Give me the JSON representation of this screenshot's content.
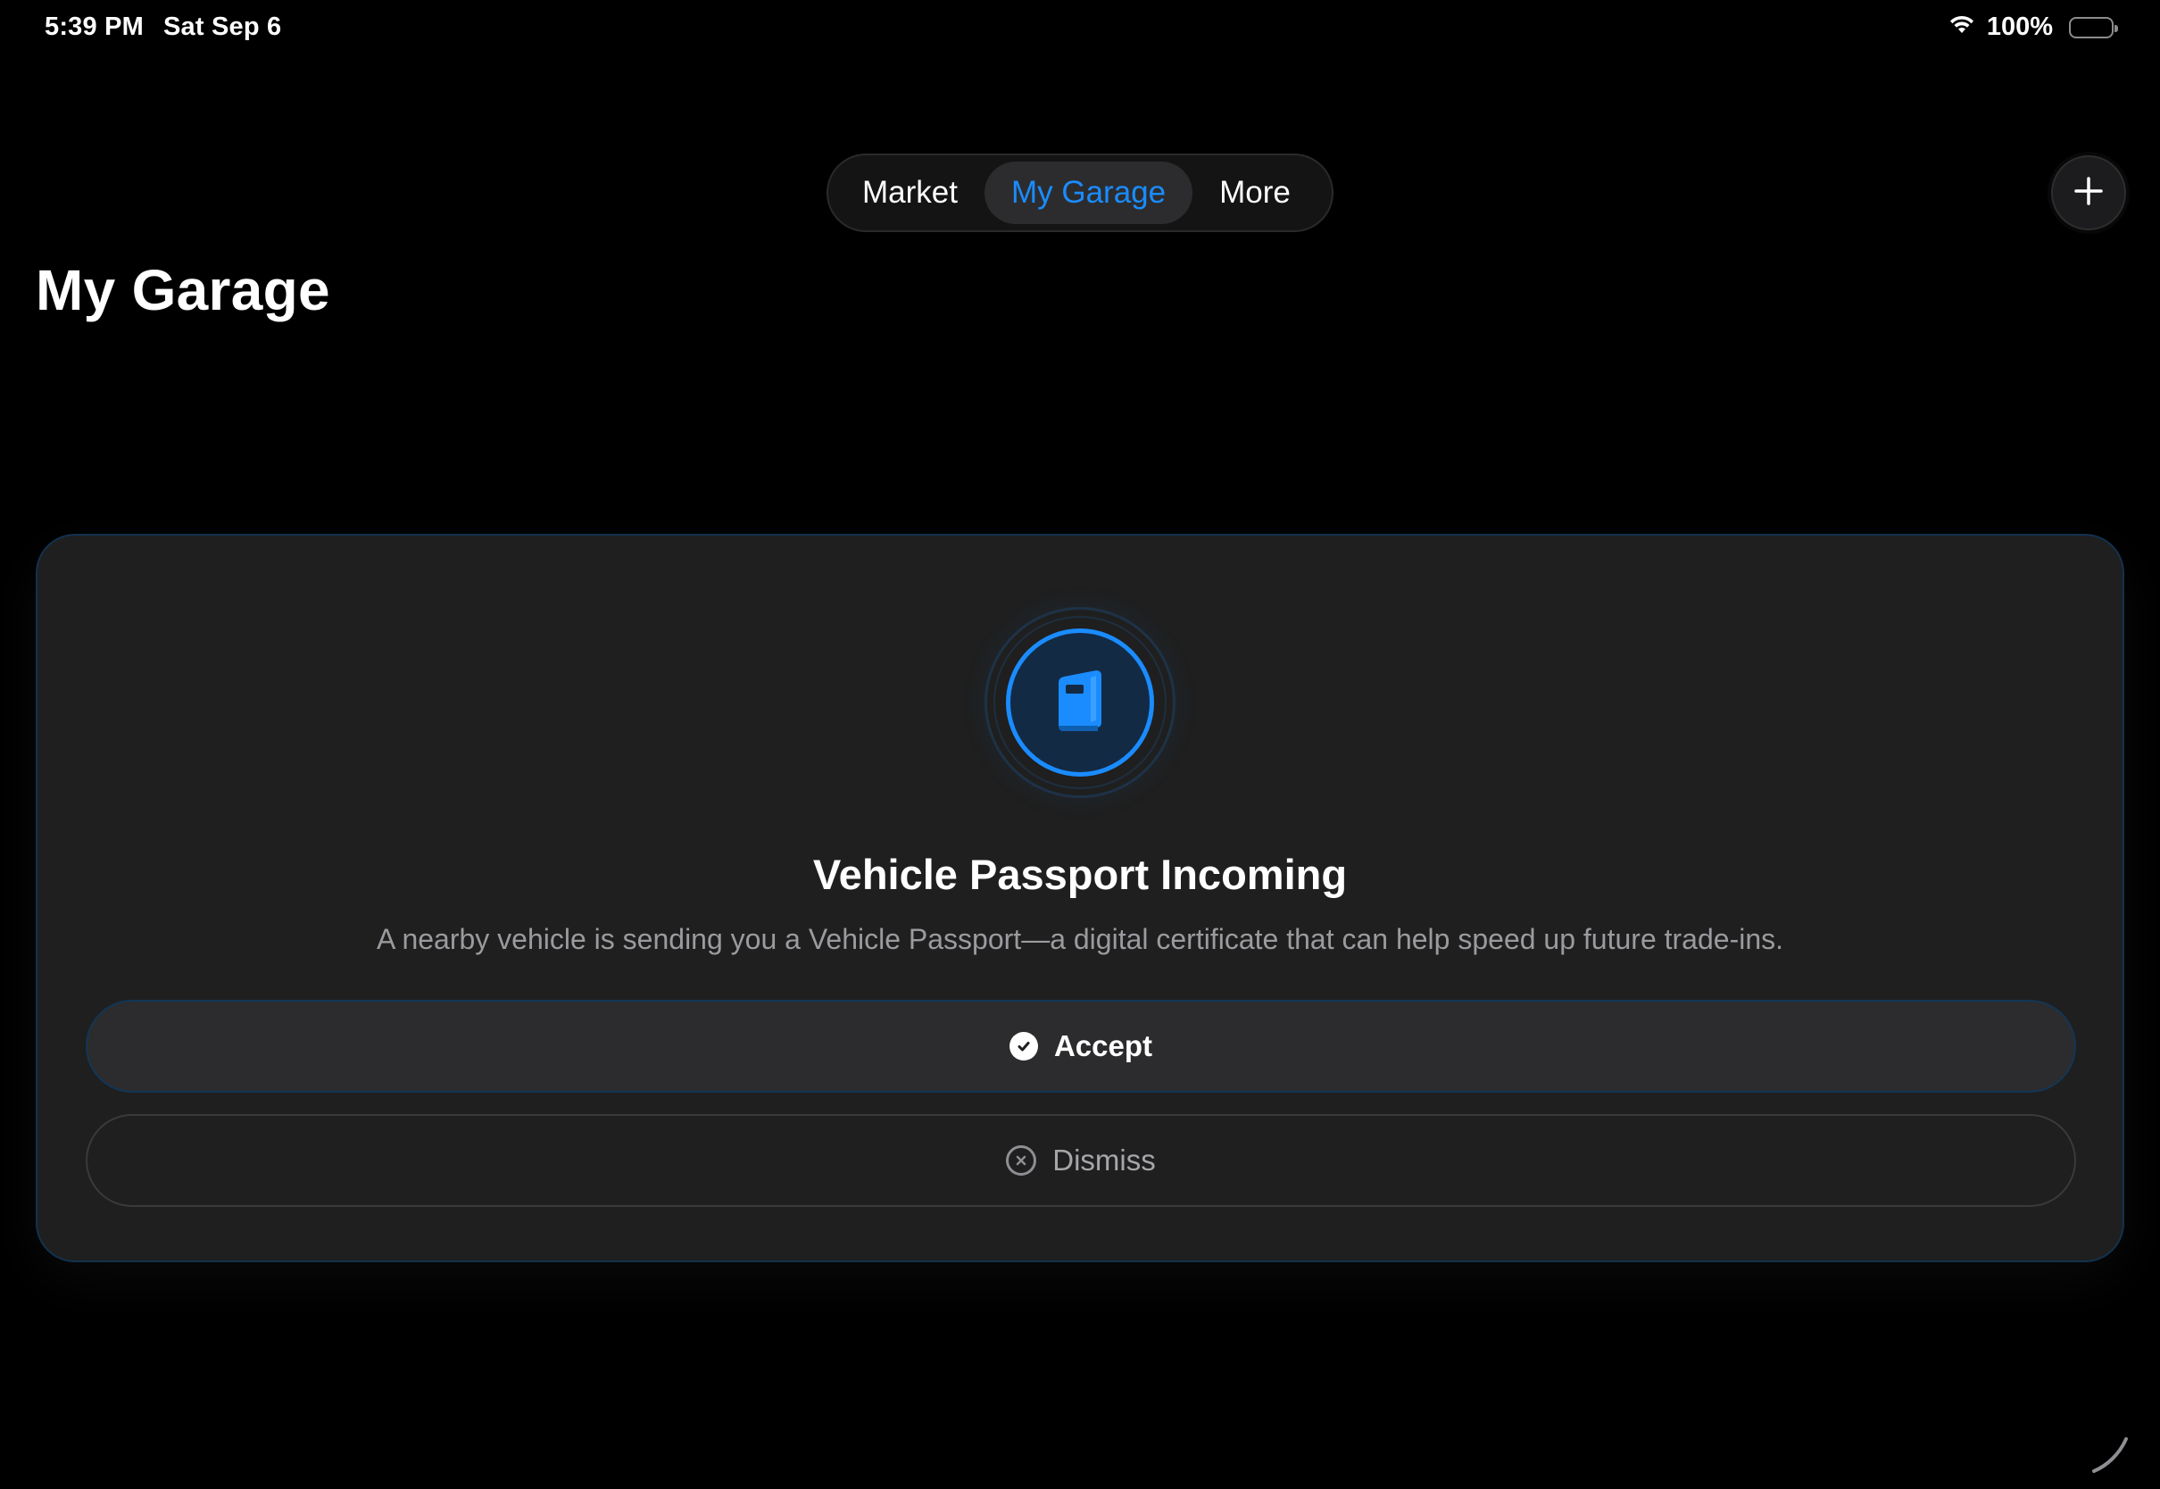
{
  "status_bar": {
    "time": "5:39 PM",
    "date": "Sat Sep 6",
    "battery_percent": "100%",
    "battery_level": 1.0,
    "icons": [
      "wifi-icon",
      "battery-icon"
    ]
  },
  "nav": {
    "tabs": [
      {
        "label": "Market",
        "active": false
      },
      {
        "label": "My Garage",
        "active": true
      },
      {
        "label": "More",
        "active": false
      }
    ],
    "add_icon": "plus-icon"
  },
  "page": {
    "title": "My Garage"
  },
  "card": {
    "icon": "book-icon",
    "title": "Vehicle Passport Incoming",
    "description": "A nearby vehicle is sending you a Vehicle Passport—a digital certificate that can help speed up future trade-ins.",
    "accept_label": "Accept",
    "accept_icon": "checkmark-circle-icon",
    "dismiss_label": "Dismiss",
    "dismiss_icon": "x-circle-icon"
  },
  "colors": {
    "accent": "#1a8cff",
    "background": "#000000",
    "card_background": "#1f1f1f",
    "secondary_text": "#9b9b9f"
  }
}
